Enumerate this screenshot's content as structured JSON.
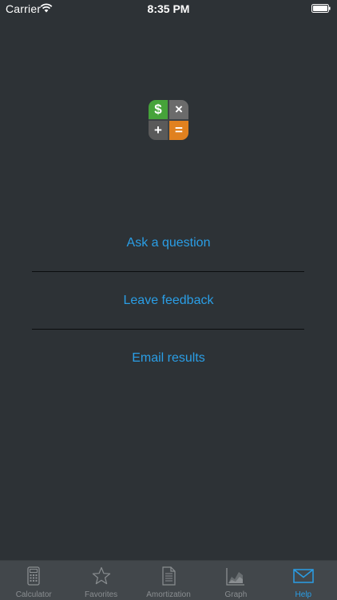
{
  "status_bar": {
    "carrier": "Carrier",
    "time": "8:35 PM"
  },
  "logo": {
    "symbols": [
      "$",
      "×",
      "+",
      "="
    ],
    "colors": [
      "#46a33a",
      "#6b6b6b",
      "#5a5a5a",
      "#e0811f"
    ]
  },
  "menu": {
    "items": [
      {
        "label": "Ask a question"
      },
      {
        "label": "Leave feedback"
      },
      {
        "label": "Email results"
      }
    ]
  },
  "tab_bar": {
    "active": "Help",
    "tabs": [
      {
        "label": "Calculator",
        "icon": "calculator-icon"
      },
      {
        "label": "Favorites",
        "icon": "star-icon"
      },
      {
        "label": "Amortization",
        "icon": "document-icon"
      },
      {
        "label": "Graph",
        "icon": "graph-icon"
      },
      {
        "label": "Help",
        "icon": "envelope-icon"
      }
    ]
  },
  "colors": {
    "background": "#2d3236",
    "accent": "#2a9ee6",
    "tab_bar": "#42474b",
    "inactive_tab": "#8a8e91"
  }
}
